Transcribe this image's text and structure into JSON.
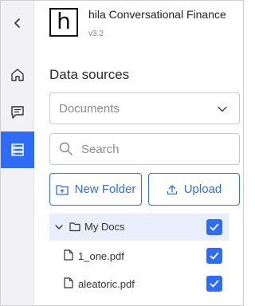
{
  "app": {
    "logo_letter": "h",
    "title": "hila Conversational Finance",
    "version": "v3.2"
  },
  "rail": {
    "items": [
      {
        "icon": "chevron-left-icon"
      },
      {
        "icon": "home-icon"
      },
      {
        "icon": "chat-icon"
      },
      {
        "icon": "data-sources-icon",
        "active": true
      }
    ],
    "accent_color": "#2f6cf5"
  },
  "panel": {
    "title": "Data sources",
    "source_select": {
      "value": "Documents"
    },
    "search": {
      "placeholder": "Search",
      "value": ""
    },
    "new_folder_label": "New Folder",
    "upload_label": "Upload"
  },
  "tree": {
    "root": {
      "label": "My Docs",
      "expanded": true,
      "checked": true
    },
    "files": [
      {
        "label": "1_one.pdf",
        "checked": true
      },
      {
        "label": "aleatoric.pdf",
        "checked": true
      }
    ]
  },
  "colors": {
    "accent": "#2f6cf5",
    "selected_row": "#e9eefb"
  }
}
